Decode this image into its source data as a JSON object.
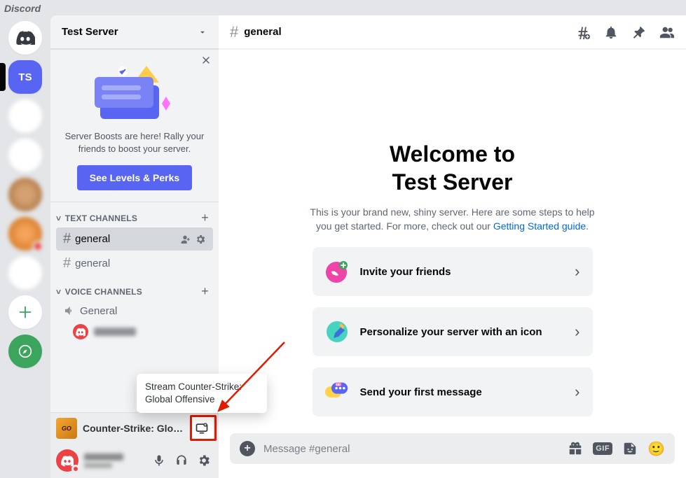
{
  "brand": "Discord",
  "rail": {
    "selected_initials": "TS"
  },
  "server": {
    "name": "Test Server"
  },
  "boost": {
    "text": "Server Boosts are here! Rally your friends to boost your server.",
    "button": "See Levels & Perks"
  },
  "categories": {
    "text": "TEXT CHANNELS",
    "voice": "VOICE CHANNELS"
  },
  "text_channels": [
    {
      "name": "general",
      "active": true
    },
    {
      "name": "general",
      "active": false
    }
  ],
  "voice_channels": [
    {
      "name": "General"
    }
  ],
  "activity": {
    "label": "Counter-Strike: Global ...",
    "game_badge": "GO"
  },
  "tooltip": {
    "text": "Stream Counter-Strike: Global Offensive"
  },
  "chat": {
    "channel_name": "general",
    "welcome_line1": "Welcome to",
    "welcome_line2": "Test Server",
    "welcome_sub_before": "This is your brand new, shiny server. Here are some steps to help you get started. For more, check out our ",
    "welcome_link": "Getting Started guide",
    "welcome_sub_after": "."
  },
  "onboarding": [
    "Invite your friends",
    "Personalize your server with an icon",
    "Send your first message"
  ],
  "composer": {
    "placeholder": "Message #general",
    "gif": "GIF"
  }
}
